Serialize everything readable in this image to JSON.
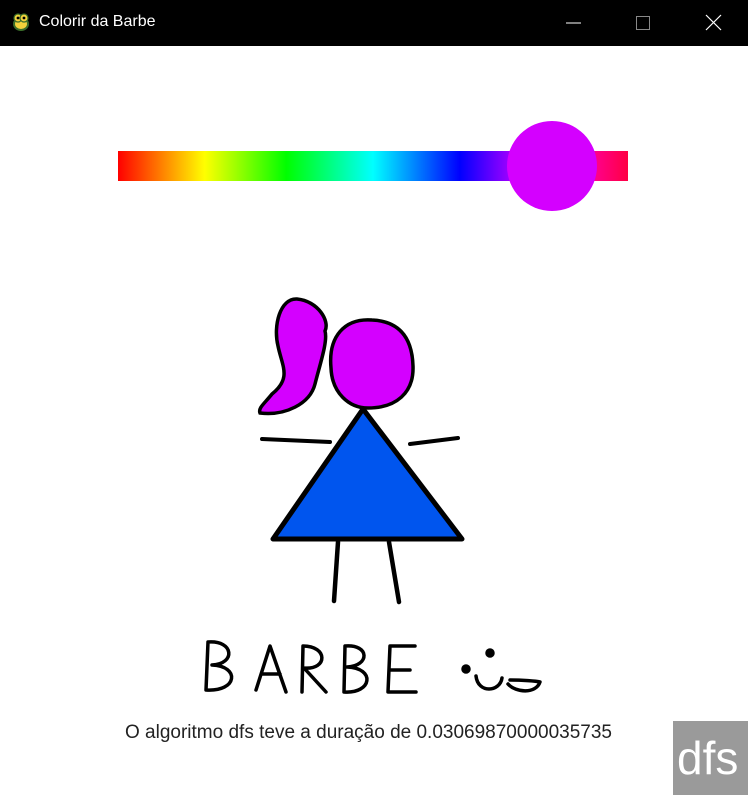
{
  "window": {
    "title": "Colorir da Barbe",
    "app_icon": "python-snake-icon",
    "controls": {
      "minimize_icon": "minimize-icon",
      "maximize_icon": "maximize-icon",
      "close_icon": "close-icon"
    }
  },
  "hue_slider": {
    "selected_color": "#d400ff",
    "position_fraction": 0.85
  },
  "drawing": {
    "caption": "BARBE",
    "hair_color": "#d400ff",
    "dress_color": "#0055ee",
    "outline_color": "#000000"
  },
  "status": {
    "text": "O algoritmo dfs teve a duração de 0.03069870000035735"
  },
  "algorithm_badge": {
    "label": "dfs",
    "color": "#9a9a9a"
  }
}
